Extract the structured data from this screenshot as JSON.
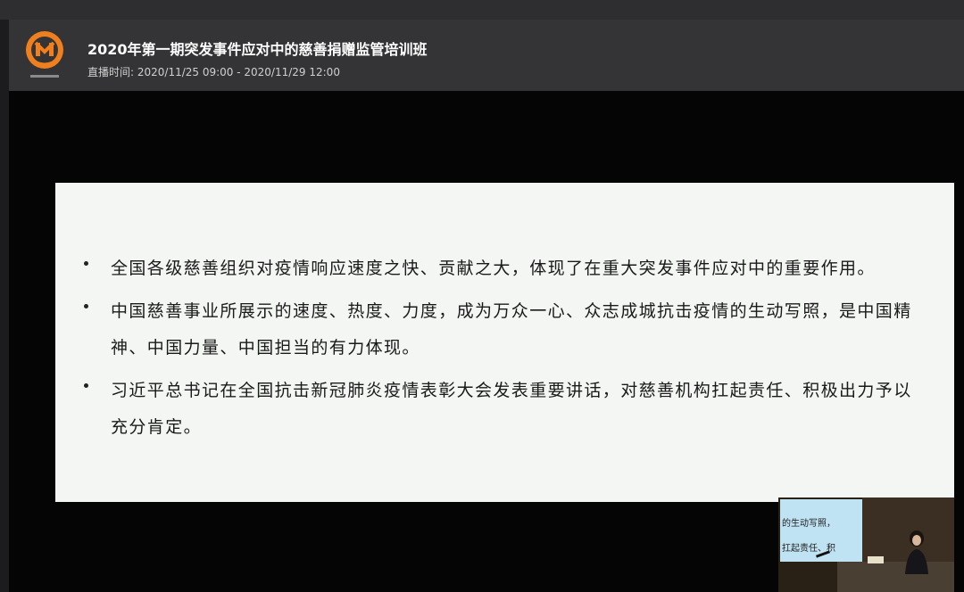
{
  "header": {
    "title": "2020年第一期突发事件应对中的慈善捐赠监管培训班",
    "time_label": "直播时间:",
    "time_range": "2020/11/25 09:00 - 2020/11/29 12:00",
    "logo_icon": "charity-logo-icon",
    "logo_color": "#f07f1e"
  },
  "slide": {
    "bullets": [
      "全国各级慈善组织对疫情响应速度之快、贡献之大，体现了在重大突发事件应对中的重要作用。",
      "中国慈善事业所展示的速度、热度、力度，成为万众一心、众志成城抗击疫情的生动写照，是中国精神、中国力量、中国担当的有力体现。",
      "习近平总书记在全国抗击新冠肺炎疫情表彰大会发表重要讲话，对慈善机构扛起责任、积极出力予以充分肯定。"
    ]
  },
  "pip": {
    "screen_line1": "的生动写照，",
    "screen_line2": "扛起责任、积"
  }
}
